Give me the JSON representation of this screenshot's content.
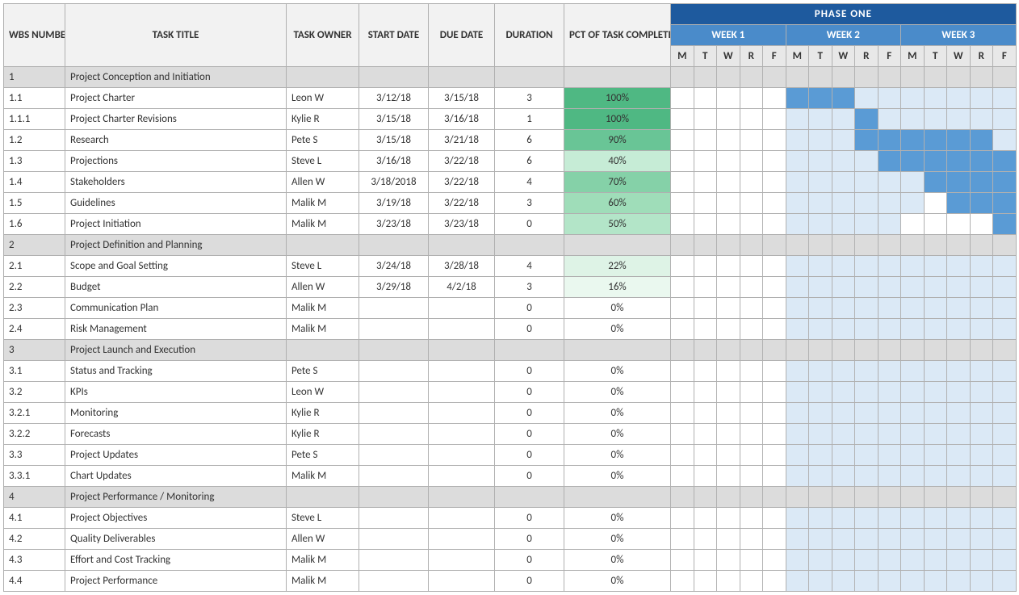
{
  "headers": {
    "wbs": "WBS NUMBER",
    "title": "TASK TITLE",
    "owner": "TASK OWNER",
    "start": "START DATE",
    "due": "DUE DATE",
    "dur": "DURATION",
    "pct": "PCT OF TASK COMPLETE",
    "phase": "PHASE ONE",
    "weeks": [
      "WEEK 1",
      "WEEK 2",
      "WEEK 3"
    ],
    "days": [
      "M",
      "T",
      "W",
      "R",
      "F",
      "M",
      "T",
      "W",
      "R",
      "F",
      "M",
      "T",
      "W",
      "R",
      "F"
    ]
  },
  "rows": [
    {
      "wbs": "1",
      "title": "Project Conception and Initiation",
      "section": true
    },
    {
      "wbs": "1.1",
      "title": "Project Charter",
      "owner": "Leon W",
      "start": "3/12/18",
      "due": "3/15/18",
      "dur": "3",
      "pct": "100%",
      "pctClass": "pct-100",
      "gantt": [
        "",
        "",
        "",
        "",
        "",
        "d",
        "d",
        "d",
        "l",
        "l",
        "l",
        "l",
        "l",
        "l",
        "l"
      ]
    },
    {
      "wbs": "1.1.1",
      "title": "Project Charter Revisions",
      "owner": "Kylie R",
      "start": "3/15/18",
      "due": "3/16/18",
      "dur": "1",
      "pct": "100%",
      "pctClass": "pct-100",
      "gantt": [
        "",
        "",
        "",
        "",
        "",
        "l",
        "l",
        "l",
        "d",
        "l",
        "l",
        "l",
        "l",
        "l",
        "l"
      ]
    },
    {
      "wbs": "1.2",
      "title": "Research",
      "owner": "Pete S",
      "start": "3/15/18",
      "due": "3/21/18",
      "dur": "6",
      "pct": "90%",
      "pctClass": "pct-90",
      "gantt": [
        "",
        "",
        "",
        "",
        "",
        "l",
        "l",
        "l",
        "d",
        "d",
        "d",
        "d",
        "d",
        "d",
        "l"
      ]
    },
    {
      "wbs": "1.3",
      "title": "Projections",
      "owner": "Steve L",
      "start": "3/16/18",
      "due": "3/22/18",
      "dur": "6",
      "pct": "40%",
      "pctClass": "pct-40",
      "gantt": [
        "",
        "",
        "",
        "",
        "",
        "l",
        "l",
        "l",
        "l",
        "d",
        "d",
        "d",
        "d",
        "d",
        "d"
      ]
    },
    {
      "wbs": "1.4",
      "title": "Stakeholders",
      "owner": "Allen W",
      "start": "3/18/2018",
      "due": "3/22/18",
      "dur": "4",
      "pct": "70%",
      "pctClass": "pct-70",
      "gantt": [
        "",
        "",
        "",
        "",
        "",
        "l",
        "l",
        "l",
        "l",
        "l",
        "l",
        "d",
        "d",
        "d",
        "d"
      ]
    },
    {
      "wbs": "1.5",
      "title": "Guidelines",
      "owner": "Malik M",
      "start": "3/19/18",
      "due": "3/22/18",
      "dur": "3",
      "pct": "60%",
      "pctClass": "pct-60",
      "gantt": [
        "",
        "",
        "",
        "",
        "",
        "l",
        "l",
        "l",
        "l",
        "l",
        "l",
        "",
        "d",
        "d",
        "d"
      ]
    },
    {
      "wbs": "1.6",
      "title": "Project Initiation",
      "owner": "Malik M",
      "start": "3/23/18",
      "due": "3/23/18",
      "dur": "0",
      "pct": "50%",
      "pctClass": "pct-50",
      "gantt": [
        "",
        "",
        "",
        "",
        "",
        "l",
        "l",
        "l",
        "l",
        "l",
        "",
        "",
        "",
        "",
        "d"
      ]
    },
    {
      "wbs": "2",
      "title": "Project Definition and Planning",
      "section": true
    },
    {
      "wbs": "2.1",
      "title": "Scope and Goal Setting",
      "owner": "Steve L",
      "start": "3/24/18",
      "due": "3/28/18",
      "dur": "4",
      "pct": "22%",
      "pctClass": "pct-22",
      "gantt": [
        "",
        "",
        "",
        "",
        "",
        "l",
        "l",
        "l",
        "l",
        "l",
        "l",
        "l",
        "l",
        "l",
        "l"
      ]
    },
    {
      "wbs": "2.2",
      "title": "Budget",
      "owner": "Allen W",
      "start": "3/29/18",
      "due": "4/2/18",
      "dur": "3",
      "pct": "16%",
      "pctClass": "pct-16",
      "gantt": [
        "",
        "",
        "",
        "",
        "",
        "l",
        "l",
        "l",
        "l",
        "l",
        "l",
        "l",
        "l",
        "l",
        "l"
      ]
    },
    {
      "wbs": "2.3",
      "title": "Communication Plan",
      "owner": "Malik M",
      "start": "",
      "due": "",
      "dur": "0",
      "pct": "0%",
      "pctClass": "",
      "gantt": [
        "",
        "",
        "",
        "",
        "",
        "l",
        "l",
        "l",
        "l",
        "l",
        "l",
        "l",
        "l",
        "l",
        "l"
      ]
    },
    {
      "wbs": "2.4",
      "title": "Risk Management",
      "owner": "Malik M",
      "start": "",
      "due": "",
      "dur": "0",
      "pct": "0%",
      "pctClass": "",
      "gantt": [
        "",
        "",
        "",
        "",
        "",
        "l",
        "l",
        "l",
        "l",
        "l",
        "l",
        "l",
        "l",
        "l",
        "l"
      ]
    },
    {
      "wbs": "3",
      "title": "Project Launch and Execution",
      "section": true
    },
    {
      "wbs": "3.1",
      "title": "Status and Tracking",
      "owner": "Pete S",
      "start": "",
      "due": "",
      "dur": "0",
      "pct": "0%",
      "pctClass": "",
      "gantt": [
        "",
        "",
        "",
        "",
        "",
        "l",
        "l",
        "l",
        "l",
        "l",
        "l",
        "l",
        "l",
        "l",
        "l"
      ]
    },
    {
      "wbs": "3.2",
      "title": "KPIs",
      "owner": "Leon W",
      "start": "",
      "due": "",
      "dur": "0",
      "pct": "0%",
      "pctClass": "",
      "gantt": [
        "",
        "",
        "",
        "",
        "",
        "l",
        "l",
        "l",
        "l",
        "l",
        "l",
        "l",
        "l",
        "l",
        "l"
      ]
    },
    {
      "wbs": "3.2.1",
      "title": "Monitoring",
      "owner": "Kylie R",
      "start": "",
      "due": "",
      "dur": "0",
      "pct": "0%",
      "pctClass": "",
      "gantt": [
        "",
        "",
        "",
        "",
        "",
        "l",
        "l",
        "l",
        "l",
        "l",
        "l",
        "l",
        "l",
        "l",
        "l"
      ]
    },
    {
      "wbs": "3.2.2",
      "title": "Forecasts",
      "owner": "Kylie R",
      "start": "",
      "due": "",
      "dur": "0",
      "pct": "0%",
      "pctClass": "",
      "gantt": [
        "",
        "",
        "",
        "",
        "",
        "l",
        "l",
        "l",
        "l",
        "l",
        "l",
        "l",
        "l",
        "l",
        "l"
      ]
    },
    {
      "wbs": "3.3",
      "title": "Project Updates",
      "owner": "Pete S",
      "start": "",
      "due": "",
      "dur": "0",
      "pct": "0%",
      "pctClass": "",
      "gantt": [
        "",
        "",
        "",
        "",
        "",
        "l",
        "l",
        "l",
        "l",
        "l",
        "l",
        "l",
        "l",
        "l",
        "l"
      ]
    },
    {
      "wbs": "3.3.1",
      "title": "Chart Updates",
      "owner": "Malik M",
      "start": "",
      "due": "",
      "dur": "0",
      "pct": "0%",
      "pctClass": "",
      "gantt": [
        "",
        "",
        "",
        "",
        "",
        "l",
        "l",
        "l",
        "l",
        "l",
        "l",
        "l",
        "l",
        "l",
        "l"
      ]
    },
    {
      "wbs": "4",
      "title": "Project Performance / Monitoring",
      "section": true
    },
    {
      "wbs": "4.1",
      "title": "Project Objectives",
      "owner": "Steve L",
      "start": "",
      "due": "",
      "dur": "0",
      "pct": "0%",
      "pctClass": "",
      "gantt": [
        "",
        "",
        "",
        "",
        "",
        "l",
        "l",
        "l",
        "l",
        "l",
        "l",
        "l",
        "l",
        "l",
        "l"
      ]
    },
    {
      "wbs": "4.2",
      "title": "Quality Deliverables",
      "owner": "Allen W",
      "start": "",
      "due": "",
      "dur": "0",
      "pct": "0%",
      "pctClass": "",
      "gantt": [
        "",
        "",
        "",
        "",
        "",
        "l",
        "l",
        "l",
        "l",
        "l",
        "l",
        "l",
        "l",
        "l",
        "l"
      ]
    },
    {
      "wbs": "4.3",
      "title": "Effort and Cost Tracking",
      "owner": "Malik M",
      "start": "",
      "due": "",
      "dur": "0",
      "pct": "0%",
      "pctClass": "",
      "gantt": [
        "",
        "",
        "",
        "",
        "",
        "l",
        "l",
        "l",
        "l",
        "l",
        "l",
        "l",
        "l",
        "l",
        "l"
      ]
    },
    {
      "wbs": "4.4",
      "title": "Project Performance",
      "owner": "Malik M",
      "start": "",
      "due": "",
      "dur": "0",
      "pct": "0%",
      "pctClass": "",
      "gantt": [
        "",
        "",
        "",
        "",
        "",
        "l",
        "l",
        "l",
        "l",
        "l",
        "l",
        "l",
        "l",
        "l",
        "l"
      ]
    }
  ]
}
